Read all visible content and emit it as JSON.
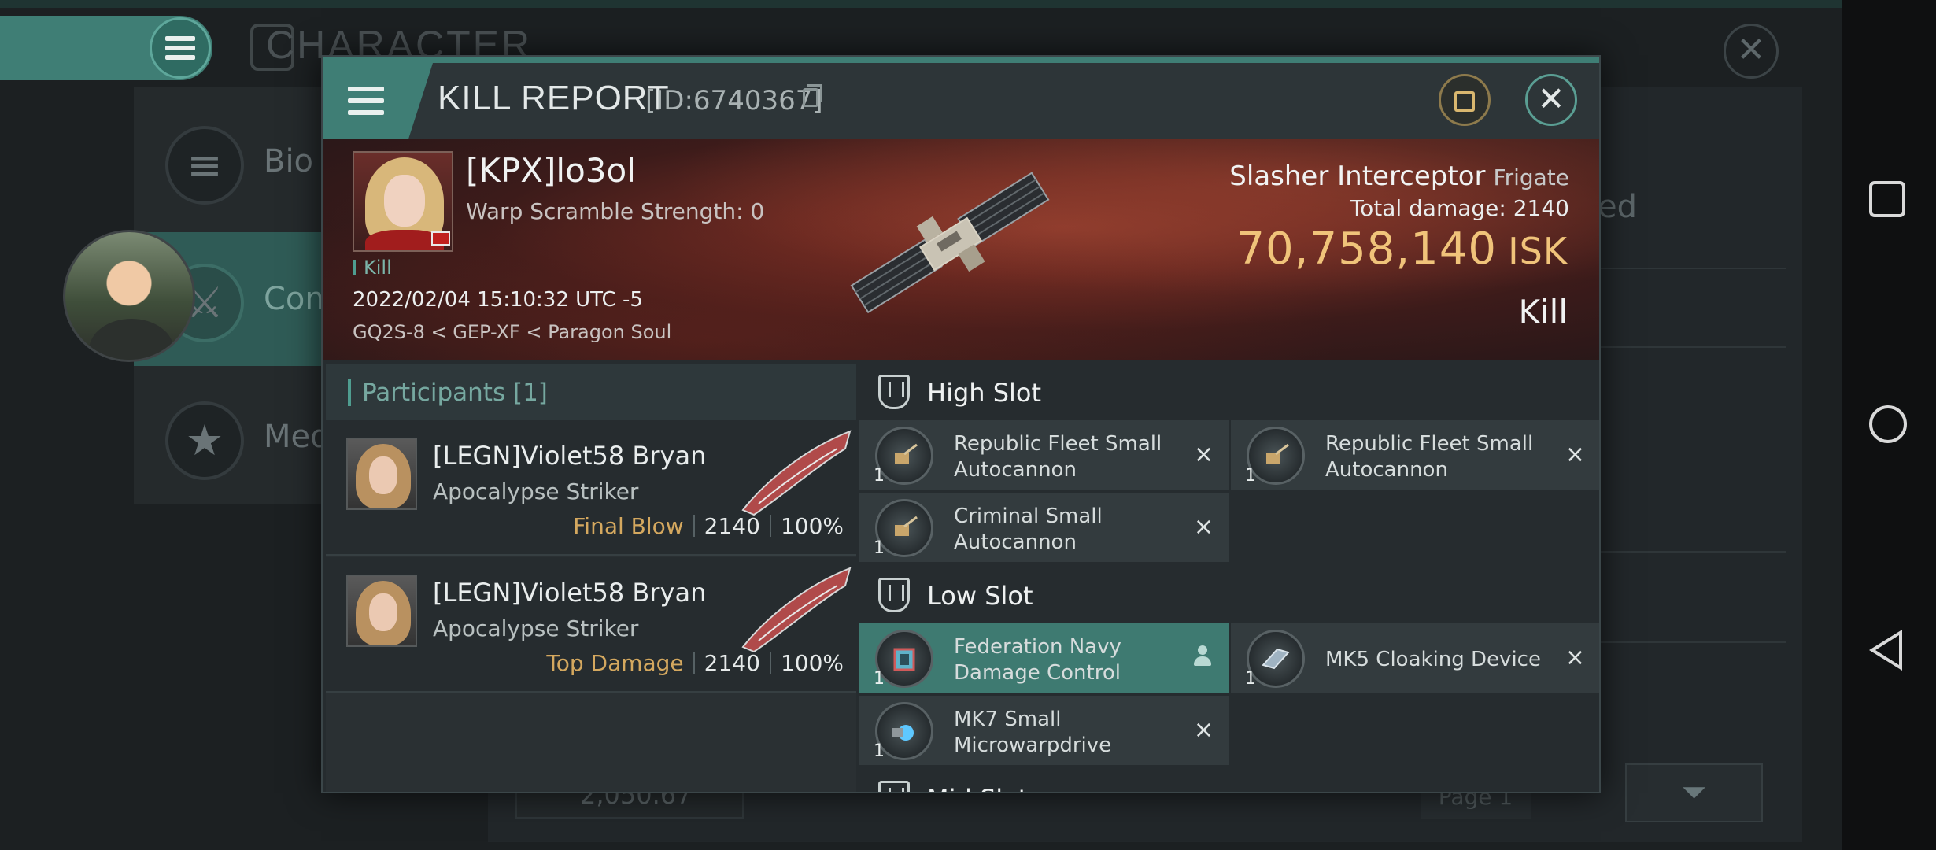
{
  "background": {
    "title": "CHARACTER",
    "nav": [
      {
        "label": "Bio"
      },
      {
        "label": "Com"
      },
      {
        "label": "Med"
      }
    ],
    "right_text": "ed",
    "bottom_value": "2,050.67",
    "page_label": "Page 1"
  },
  "dialog": {
    "title": "KILL REPORT",
    "id_label": "[ID:6740367]"
  },
  "victim": {
    "name": "[KPX]lo3ol",
    "warp_scramble": "Warp Scramble Strength: 0",
    "kill_tag": "Kill",
    "date": "2022/02/04 15:10:32 UTC -5",
    "location": "GQ2S-8 < GEP-XF < Paragon Soul"
  },
  "ship": {
    "name": "Slasher Interceptor",
    "class": "Frigate",
    "total_damage_label": "Total damage:",
    "total_damage": "2140",
    "isk_value": "70,758,140",
    "isk_unit": "ISK",
    "result": "Kill"
  },
  "participants": {
    "title": "Participants",
    "count": "[1]",
    "rows": [
      {
        "name": "[LEGN]Violet58 Bryan",
        "ship": "Apocalypse Striker",
        "tag": "Final Blow",
        "damage": "2140",
        "percent": "100%"
      },
      {
        "name": "[LEGN]Violet58 Bryan",
        "ship": "Apocalypse Striker",
        "tag": "Top Damage",
        "damage": "2140",
        "percent": "100%"
      }
    ]
  },
  "fitting": {
    "high_slot": {
      "title": "High Slot",
      "modules": [
        {
          "name": "Republic Fleet Small Autocannon",
          "qty": "1",
          "action": "×"
        },
        {
          "name": "Republic Fleet Small Autocannon",
          "qty": "1",
          "action": "×"
        },
        {
          "name": "Criminal Small Autocannon",
          "qty": "1",
          "action": "×"
        }
      ]
    },
    "low_slot": {
      "title": "Low Slot",
      "modules": [
        {
          "name": "Federation Navy Damage Control",
          "qty": "1",
          "action": "person"
        },
        {
          "name": "MK5 Cloaking Device",
          "qty": "1",
          "action": "×"
        },
        {
          "name": "MK7 Small Microwarpdrive",
          "qty": "1",
          "action": "×"
        }
      ]
    },
    "next_slot_title": "Mid Slot"
  },
  "colors": {
    "accent": "#3f7e75",
    "isk": "#f0c37a",
    "tag_gold": "#d4a85f"
  }
}
